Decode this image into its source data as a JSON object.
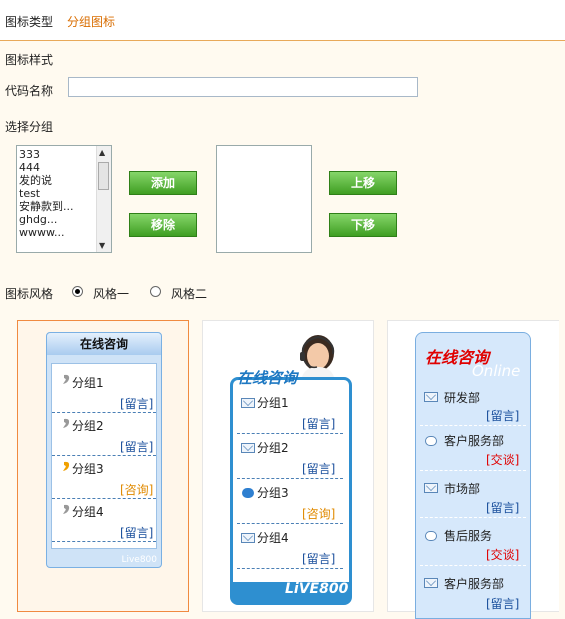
{
  "header": {
    "icon_type_label": "图标类型",
    "icon_type_value": "分组图标"
  },
  "form": {
    "icon_style_label": "图标样式",
    "code_name_label": "代码名称",
    "code_name_value": "",
    "select_group_label": "选择分组",
    "group_list": [
      "333",
      "444",
      "发的说",
      "test",
      "安静款到...",
      "ghdg...",
      "wwww..."
    ],
    "add_button": "添加",
    "remove_button": "移除",
    "move_up_button": "上移",
    "move_down_button": "下移",
    "icon_style_radio_label": "图标风格",
    "style_one": "风格一",
    "style_two": "风格二",
    "selected_style": "风格一"
  },
  "previews": {
    "style1": {
      "title": "在线咨询",
      "footer": "Live800",
      "groups": [
        {
          "name": "分组1",
          "link": "[留言]"
        },
        {
          "name": "分组2",
          "link": "[留言]"
        },
        {
          "name": "分组3",
          "link": "[咨询]"
        },
        {
          "name": "分组4",
          "link": "[留言]"
        }
      ]
    },
    "style2": {
      "title": "在线咨询",
      "footer": "LiVE800",
      "groups": [
        {
          "name": "分组1",
          "link": "[留言]"
        },
        {
          "name": "分组2",
          "link": "[留言]"
        },
        {
          "name": "分组3",
          "link": "[咨询]"
        },
        {
          "name": "分组4",
          "link": "[留言]"
        }
      ]
    },
    "style3": {
      "title": "在线咨询",
      "subtitle": "Online",
      "departments": [
        {
          "name": "研发部",
          "link": "[留言]"
        },
        {
          "name": "客户服务部",
          "link": "[交谈]"
        },
        {
          "name": "市场部",
          "link": "[留言]"
        },
        {
          "name": "售后服务",
          "link": "[交谈]"
        },
        {
          "name": "客户服务部",
          "link": "[留言]"
        }
      ]
    }
  },
  "colors": {
    "accent": "#d96d00",
    "button_green": "#3f9e22",
    "link_blue": "#1a4f9c",
    "link_orange": "#e08a00",
    "link_red": "#e00000"
  }
}
